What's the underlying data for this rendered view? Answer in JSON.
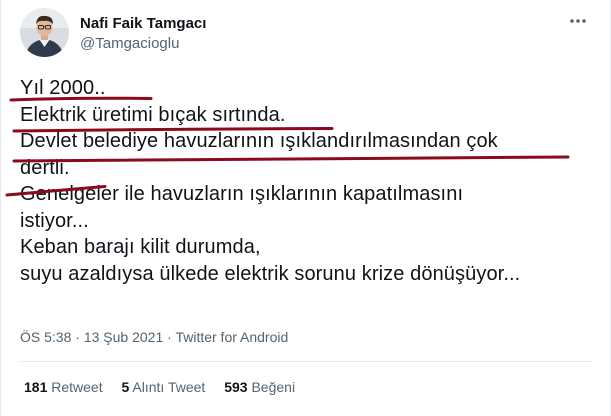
{
  "author": {
    "display_name": "Nafi Faik Tamgacı",
    "handle": "@Tamgacioglu"
  },
  "tweet": {
    "lines": [
      "Yıl 2000..",
      "Elektrik üretimi bıçak sırtında.",
      "Devlet belediye havuzlarının ışıklandırılmasından çok",
      "dertli.",
      "Genelgeler ile havuzların ışıklarının kapatılmasını",
      "istiyor...",
      "Keban barajı kilit durumda,",
      "suyu azaldıysa ülkede elektrik sorunu krize dönüşüyor..."
    ]
  },
  "meta": {
    "time": "ÖS 5:38",
    "separator": "·",
    "date": "13 Şub 2021",
    "source": "Twitter for Android"
  },
  "stats": {
    "retweets": {
      "count": "181",
      "label": "Retweet"
    },
    "quotes": {
      "count": "5",
      "label": "Alıntı Tweet"
    },
    "likes": {
      "count": "593",
      "label": "Beğeni"
    }
  },
  "icons": {
    "more": "more-horizontal-icon"
  },
  "colors": {
    "text": "#0f1419",
    "secondary": "#536471",
    "divider": "#e6ecf0",
    "annotation": "#8b0a1e"
  }
}
